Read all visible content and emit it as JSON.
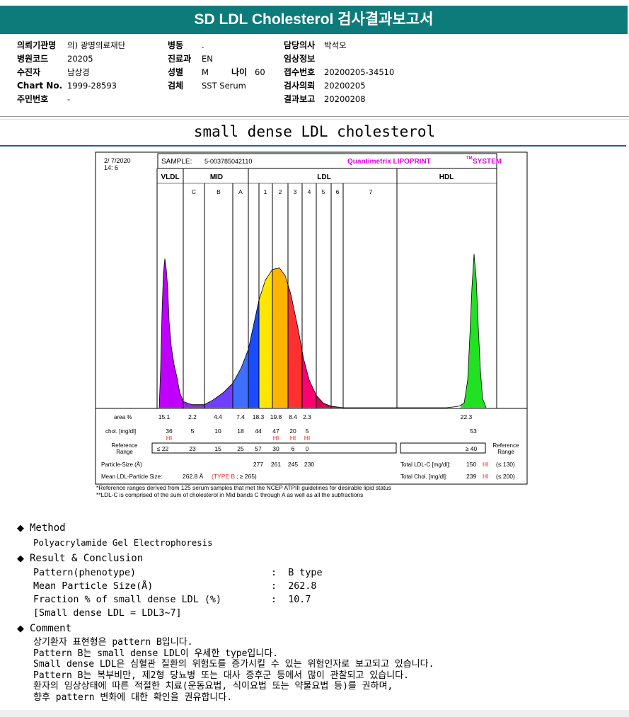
{
  "header": {
    "title": "SD LDL Cholesterol 검사결과보고서"
  },
  "patient_info": {
    "col1": [
      {
        "label": "의뢰기관명",
        "value": "의) 광명의료재단"
      },
      {
        "label": "병원코드",
        "value": "20205"
      },
      {
        "label": "수진자",
        "value": "남상경"
      },
      {
        "label": "Chart No.",
        "value": "1999-28593"
      },
      {
        "label": "주민번호",
        "value": "-"
      }
    ],
    "col2": [
      {
        "label": "병동",
        "value": "."
      },
      {
        "label": "진료과",
        "value": "EN"
      },
      {
        "label": "성별",
        "value": "M"
      },
      {
        "label": "검체",
        "value": "SST Serum"
      }
    ],
    "age": {
      "label": "나이",
      "value": "60"
    },
    "col3": [
      {
        "label": "담당의사",
        "value": "박석오"
      },
      {
        "label": "임상정보",
        "value": ""
      },
      {
        "label": "접수번호",
        "value": "20200205-34510"
      },
      {
        "label": "검사의뢰",
        "value": "20200205"
      },
      {
        "label": "결과보고",
        "value": "20200208"
      }
    ]
  },
  "subtitle": "small dense LDL cholesterol",
  "chart_data": {
    "type": "area",
    "date": "2/ 7/2020",
    "time": "14: 6",
    "sample_label": "SAMPLE:",
    "sample_id": "5-003785042110",
    "brand": "Quantimetrix LIPOPRINT",
    "brand_tm": "TM",
    "brand_suffix": "SYSTEM",
    "groups": [
      "VLDL",
      "MID",
      "LDL",
      "HDL"
    ],
    "bands": [
      "C",
      "B",
      "A",
      "1",
      "2",
      "3",
      "4",
      "5",
      "6",
      "7"
    ],
    "area_label": "area %",
    "area_values": [
      "15.1",
      "2.2",
      "4.4",
      "7.4",
      "18.3",
      "19.8",
      "8.4",
      "2.3",
      "22.3"
    ],
    "chol_label": "chol. [mg/dl]",
    "chol_values": [
      "36",
      "5",
      "10",
      "18",
      "44",
      "47",
      "20",
      "5",
      "53"
    ],
    "hi_flag": "HI",
    "reference_label": "Reference Range",
    "reference_right_label": "Reference Range",
    "reference_values": [
      "≤ 22",
      "23",
      "15",
      "25",
      "57",
      "30",
      "6",
      "0"
    ],
    "hdl_reference": "≥ 40",
    "particle_size_label": "Particle-Size (Å)",
    "particle_sizes": [
      "277",
      "261",
      "245",
      "230"
    ],
    "mean_size_label": "Mean LDL-Particle Size:",
    "mean_size_value": "262.8 Å",
    "mean_size_type": "(TYPE B",
    "mean_size_ref": "; ≥ 265)",
    "total_ldl_label": "Total LDL-C [mg/dl]:",
    "total_ldl_value": "150",
    "total_ldl_ref": "(≤ 130)",
    "total_chol_label": "Total Chol. [mg/dl]:",
    "total_chol_value": "239",
    "total_chol_ref": "(≤ 200)",
    "band_colors": [
      "#c000ff",
      "#7a00ff",
      "#6f3fff",
      "#3f6fff",
      "#1050ff",
      "#ffd800",
      "#ffb000",
      "#ff3030",
      "#ff0066",
      "#cc0044",
      "#00cc00"
    ]
  },
  "footnotes": [
    "*Reference ranges derived from 125 serum samples that met the NCEP ATPIII guidelines for desirable lipid status",
    "**LDL-C is comprised of the sum of cholesterol in Mid bands C through A as well as all the subfractions"
  ],
  "method": {
    "heading": "Method",
    "text": "Polyacrylamide Gel Electrophoresis"
  },
  "result": {
    "heading": "Result & Conclusion",
    "rows": [
      {
        "label": "Pattern(phenotype)",
        "value": "B type"
      },
      {
        "label": "Mean Particle Size(Å)",
        "value": "262.8"
      },
      {
        "label": "Fraction % of small dense LDL (%)",
        "value": "10.7"
      }
    ],
    "note": "[Small dense LDL = LDL3~7]"
  },
  "comment": {
    "heading": "Comment",
    "lines": [
      "상기환자 표현형은 pattern B입니다.",
      "Pattern B는 small dense LDL이 우세한 type입니다.",
      "Small dense LDL은 심혈관 질환의 위험도를 증가시킬 수 있는 위험인자로 보고되고 있습니다.",
      "Pattern B는 복부비만, 제2형 당뇨병 또는 대사 증후군 등에서 많이 관찰되고 있습니다.",
      "환자의 임상상태에 따른 적절한 치료(운동요법, 식이요법 또는 약물요법 등)를 권하며,",
      "향후 pattern 변화에 대한 확인을 권유합니다."
    ]
  }
}
